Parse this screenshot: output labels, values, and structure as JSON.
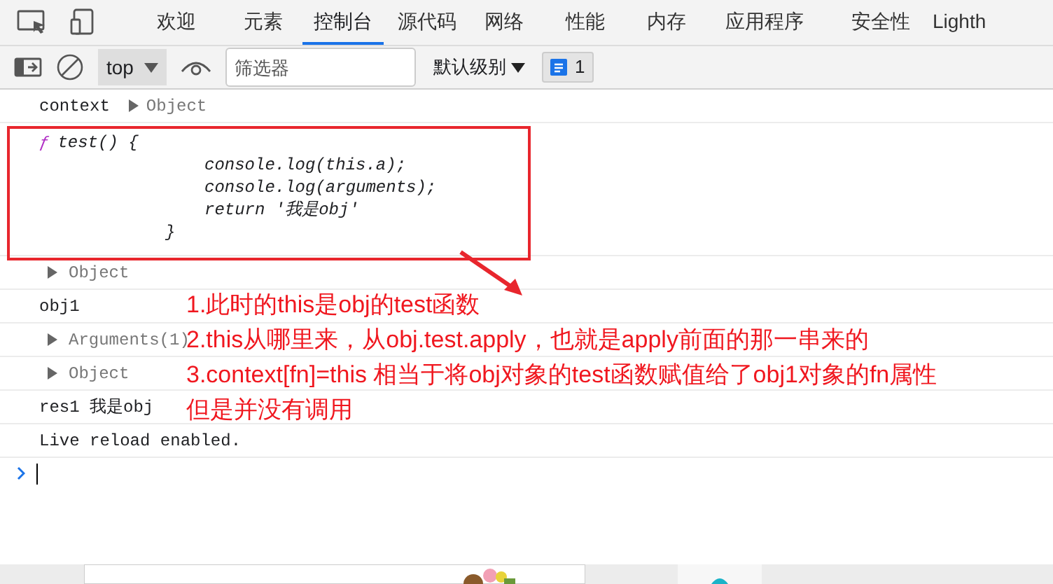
{
  "tabs": [
    {
      "label": "欢迎",
      "selected": false
    },
    {
      "label": "元素",
      "selected": false
    },
    {
      "label": "控制台",
      "selected": true
    },
    {
      "label": "源代码",
      "selected": false
    },
    {
      "label": "网络",
      "selected": false
    },
    {
      "label": "性能",
      "selected": false
    },
    {
      "label": "内存",
      "selected": false
    },
    {
      "label": "应用程序",
      "selected": false
    },
    {
      "label": "安全性",
      "selected": false
    },
    {
      "label": "Lighth",
      "selected": false
    }
  ],
  "toolbar": {
    "context": "top",
    "filter_placeholder": "筛选器",
    "level": "默认级别",
    "issues_count": "1"
  },
  "console": [
    {
      "kind": "log",
      "text": "context",
      "value": "Object"
    },
    {
      "kind": "function",
      "keyword": "ƒ",
      "header": "test() {",
      "body": [
        "console.log(this.a);",
        "console.log(arguments);",
        "return '我是obj'"
      ],
      "close": "}"
    },
    {
      "kind": "object",
      "value": "Object"
    },
    {
      "kind": "text",
      "text": "obj1"
    },
    {
      "kind": "object",
      "value": "Arguments(1)"
    },
    {
      "kind": "object",
      "value": "Object"
    },
    {
      "kind": "text",
      "text": "res1 我是obj"
    },
    {
      "kind": "text",
      "text": "Live reload enabled."
    }
  ],
  "annotation": [
    "1.此时的this是obj的test函数",
    "2.this从哪里来，从obj.test.apply，也就是apply前面的那一串来的",
    "3.context[fn]=this 相当于将obj对象的test函数赋值给了obj1对象的fn属性",
    "但是并没有调用"
  ]
}
